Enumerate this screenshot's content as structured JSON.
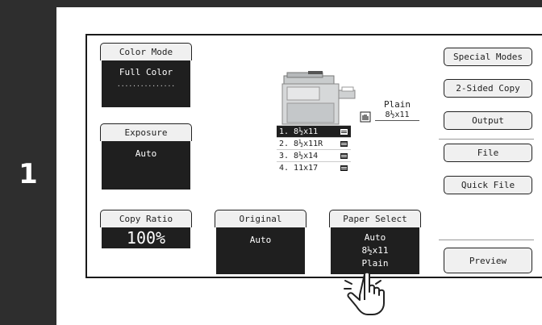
{
  "step": "1",
  "color_mode": {
    "label": "Color Mode",
    "value": "Full Color",
    "level_dots": "..............."
  },
  "exposure": {
    "label": "Exposure",
    "value": "Auto"
  },
  "copy_ratio": {
    "label": "Copy Ratio",
    "value": "100%"
  },
  "original": {
    "label": "Original",
    "value": "Auto"
  },
  "paper_select": {
    "label": "Paper Select",
    "lines": [
      "Auto",
      "8½x11",
      "Plain"
    ]
  },
  "output_paper": {
    "type": "Plain",
    "size": "8½x11"
  },
  "trays": [
    {
      "label": "1. 8½x11",
      "selected": true
    },
    {
      "label": "2. 8½x11R",
      "selected": false
    },
    {
      "label": "3. 8½x14",
      "selected": false
    },
    {
      "label": "4. 11x17",
      "selected": false
    }
  ],
  "right_buttons": {
    "special_modes": "Special Modes",
    "two_sided_copy": "2-Sided Copy",
    "output": "Output",
    "file": "File",
    "quick_file": "Quick File",
    "preview": "Preview"
  },
  "icons": {
    "tray_hand": "hand-tray-icon",
    "pointer": "pointing-hand-icon",
    "copier": "copier-icon"
  }
}
